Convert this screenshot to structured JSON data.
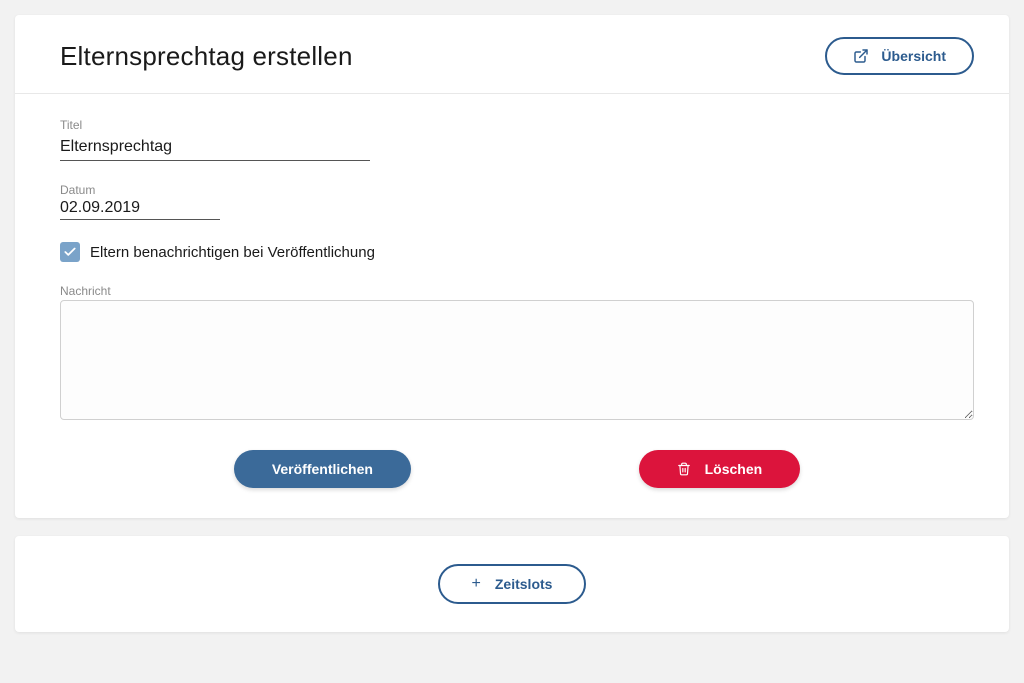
{
  "header": {
    "title": "Elternsprechtag erstellen",
    "overview_label": "Übersicht"
  },
  "form": {
    "title_label": "Titel",
    "title_value": "Elternsprechtag",
    "date_label": "Datum",
    "date_value": "02.09.2019",
    "notify_label": "Eltern benachrichtigen bei Veröffentlichung",
    "notify_checked": true,
    "message_label": "Nachricht",
    "message_value": ""
  },
  "actions": {
    "publish_label": "Veröffentlichen",
    "delete_label": "Löschen",
    "timeslots_label": "Zeitslots"
  }
}
